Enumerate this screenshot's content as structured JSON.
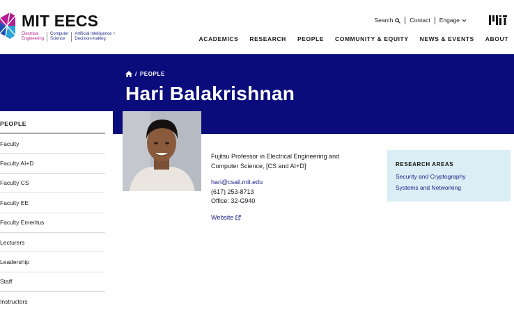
{
  "logo": {
    "title": "MIT EECS",
    "sub": [
      "Electrical\nEngineering",
      "Computer\nScience",
      "Artificial Intelligence +\nDecision-making"
    ]
  },
  "utility": {
    "search": "Search",
    "contact": "Contact",
    "engage": "Engage"
  },
  "nav": [
    "ACADEMICS",
    "RESEARCH",
    "PEOPLE",
    "COMMUNITY & EQUITY",
    "NEWS & EVENTS",
    "ABOUT"
  ],
  "breadcrumb": {
    "section": "PEOPLE"
  },
  "person": {
    "name": "Hari Balakrishnan",
    "title": "Fujitsu Professor in Electrical Engineering and\nComputer Science, [CS and AI+D]",
    "email": "hari@csail.mit.edu",
    "phone": "(617) 253-8713",
    "office": "Office: 32-G940",
    "website": "Website"
  },
  "sidebar": {
    "heading": "PEOPLE",
    "items": [
      "Faculty",
      "Faculty AI+D",
      "Faculty CS",
      "Faculty EE",
      "Faculty Emeritus",
      "Lecturers",
      "Leadership",
      "Staff",
      "Instructors"
    ]
  },
  "research": {
    "heading": "RESEARCH AREAS",
    "items": [
      "Security and Cryptography",
      "Systems and Networking"
    ]
  },
  "colors": {
    "hero": "#0b0c7b",
    "link": "#1b1f86",
    "research_bg": "#daeef5"
  }
}
